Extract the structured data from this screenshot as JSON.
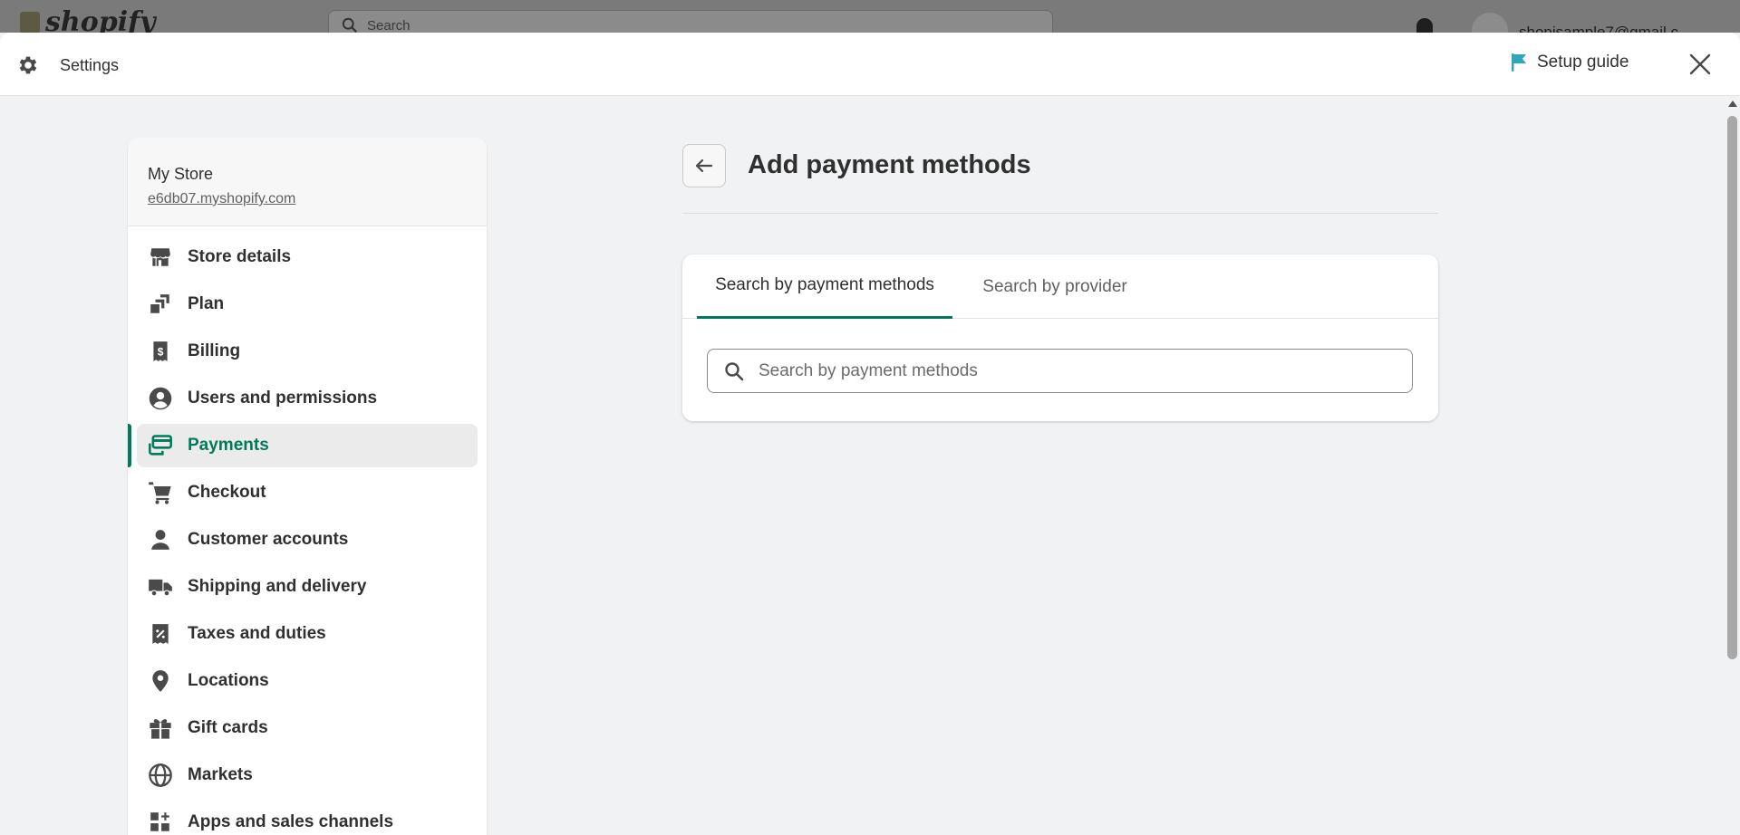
{
  "background": {
    "logo_text": "shopify",
    "search_placeholder": "Search",
    "email": "shopisample7@gmail.c"
  },
  "header": {
    "title": "Settings",
    "setup_guide": "Setup guide",
    "accent_color": "#2fa7b8"
  },
  "store": {
    "name": "My Store",
    "url": "e6db07.myshopify.com"
  },
  "sidebar": {
    "items": [
      {
        "label": "Store details",
        "icon": "store-icon"
      },
      {
        "label": "Plan",
        "icon": "plan-icon"
      },
      {
        "label": "Billing",
        "icon": "billing-icon"
      },
      {
        "label": "Users and permissions",
        "icon": "user-circle-icon"
      },
      {
        "label": "Payments",
        "icon": "payments-icon",
        "active": true
      },
      {
        "label": "Checkout",
        "icon": "cart-icon"
      },
      {
        "label": "Customer accounts",
        "icon": "person-icon"
      },
      {
        "label": "Shipping and delivery",
        "icon": "truck-icon"
      },
      {
        "label": "Taxes and duties",
        "icon": "tax-icon"
      },
      {
        "label": "Locations",
        "icon": "location-pin-icon"
      },
      {
        "label": "Gift cards",
        "icon": "gift-icon"
      },
      {
        "label": "Markets",
        "icon": "globe-icon"
      },
      {
        "label": "Apps and sales channels",
        "icon": "apps-icon"
      }
    ],
    "active_color": "#007a5a"
  },
  "main": {
    "title": "Add payment methods",
    "tabs": [
      {
        "label": "Search by payment methods",
        "active": true
      },
      {
        "label": "Search by provider",
        "active": false
      }
    ],
    "search_placeholder": "Search by payment methods"
  }
}
